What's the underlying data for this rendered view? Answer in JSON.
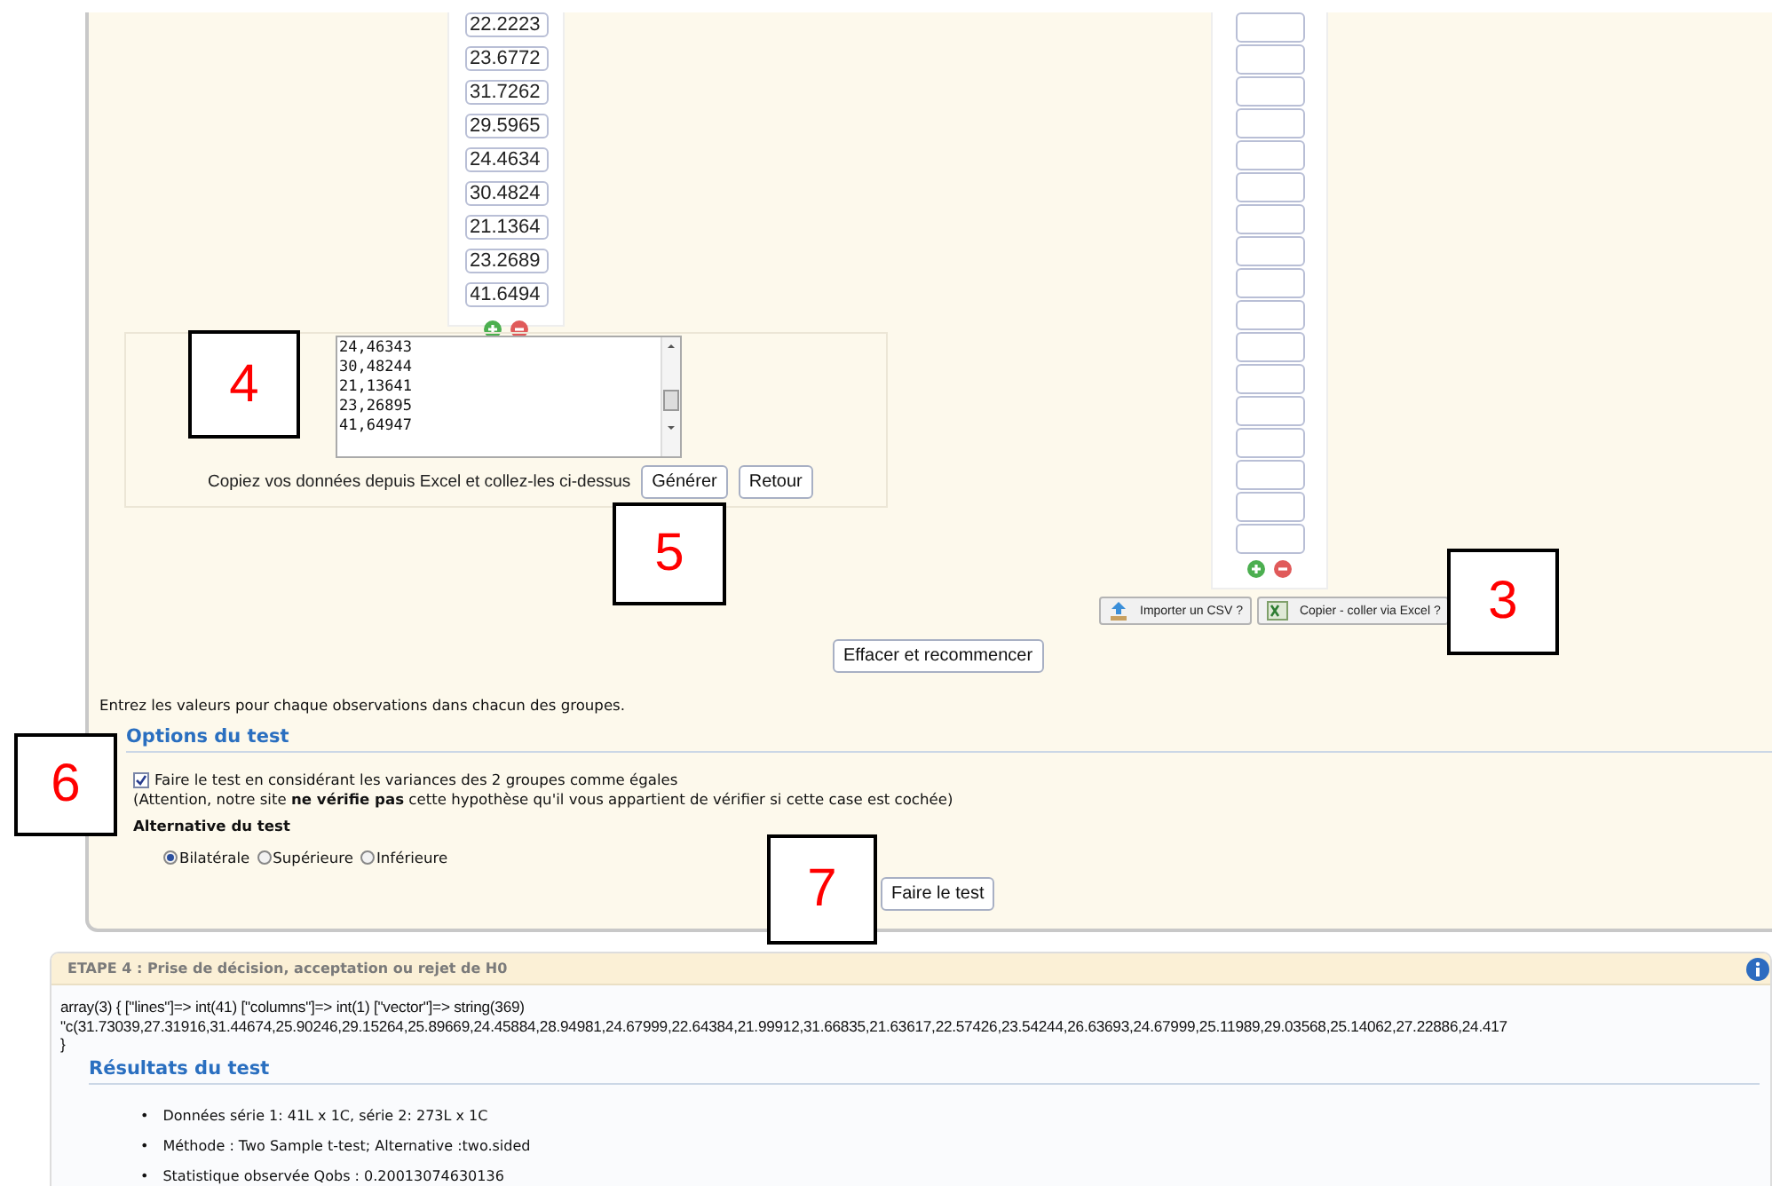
{
  "group_1": {
    "values": [
      "22.2223",
      "23.6772",
      "31.7262",
      "29.5965",
      "24.4634",
      "30.4824",
      "21.1364",
      "23.2689",
      "41.6494"
    ]
  },
  "paste_panel": {
    "textarea_lines": [
      "24,46343",
      "30,48244",
      "21,13641",
      "23,26895",
      "41,64947"
    ],
    "hint": "Copiez vos données depuis Excel et collez-les ci-dessus",
    "buttons": [
      "Générer",
      "Retour"
    ]
  },
  "group_2": {
    "fields": [
      {
        "kind": "empty"
      },
      {
        "kind": "empty"
      },
      {
        "kind": "empty"
      },
      {
        "kind": "empty"
      },
      {
        "kind": "empty"
      },
      {
        "kind": "empty"
      },
      {
        "kind": "empty"
      },
      {
        "kind": "empty"
      },
      {
        "kind": "empty"
      },
      {
        "kind": "empty"
      },
      {
        "kind": "empty"
      },
      {
        "kind": "empty"
      },
      {
        "kind": "empty"
      },
      {
        "kind": "empty"
      },
      {
        "kind": "empty"
      },
      {
        "kind": "empty"
      },
      {
        "kind": "empty"
      }
    ],
    "tools": [
      "Importer un CSV ?",
      "Copier - coller via Excel ?"
    ]
  },
  "reset_button": "Effacer et recommencer",
  "instructions": "Entrez les valeurs pour chaque observations dans chacun des groupes.",
  "options": {
    "title": "Options du test",
    "equal_variance": {
      "label": "Faire le test en considérant les variances des 2 groupes comme égales",
      "checked": true
    },
    "note": "(Attention, notre site **ne vérifie pas** cette hypothèse qu'il vous appartient de vérifier si cette case est cochée)",
    "alternative_title": "Alternative du test",
    "alternatives": [
      {
        "label": "Bilatérale",
        "selected": true
      },
      {
        "label": "Supérieure",
        "selected": false
      },
      {
        "label": "Inférieure",
        "selected": false
      }
    ],
    "run_button": "Faire le test"
  },
  "step4": {
    "title": "ETAPE 4 : Prise de décision, acceptation ou rejet de H0",
    "dump": [
      "array(3) { [\"lines\"]=> int(41) [\"columns\"]=> int(1) [\"vector\"]=> string(369)",
      "\"c(31.73039,27.31916,31.44674,25.90246,29.15264,25.89669,24.45884,28.94981,24.67999,22.64384,21.99912,31.66835,21.63617,22.57426,23.54244,26.63693,24.67999,25.11989,29.03568,25.14062,27.22886,24.417",
      "}"
    ],
    "results_title": "Résultats du test",
    "results": [
      {
        "marker": "•",
        "text": "Données  série 1: 41L x 1C,  série 2: 273L x 1C"
      },
      {
        "marker": "•",
        "text": "Méthode : Two Sample t-test; Alternative :two.sided"
      },
      {
        "marker": "•",
        "text": "Statistique observée Qobs : 0.20013074630136"
      }
    ]
  },
  "callouts": [
    "4",
    "5",
    "3",
    "6",
    "7"
  ]
}
